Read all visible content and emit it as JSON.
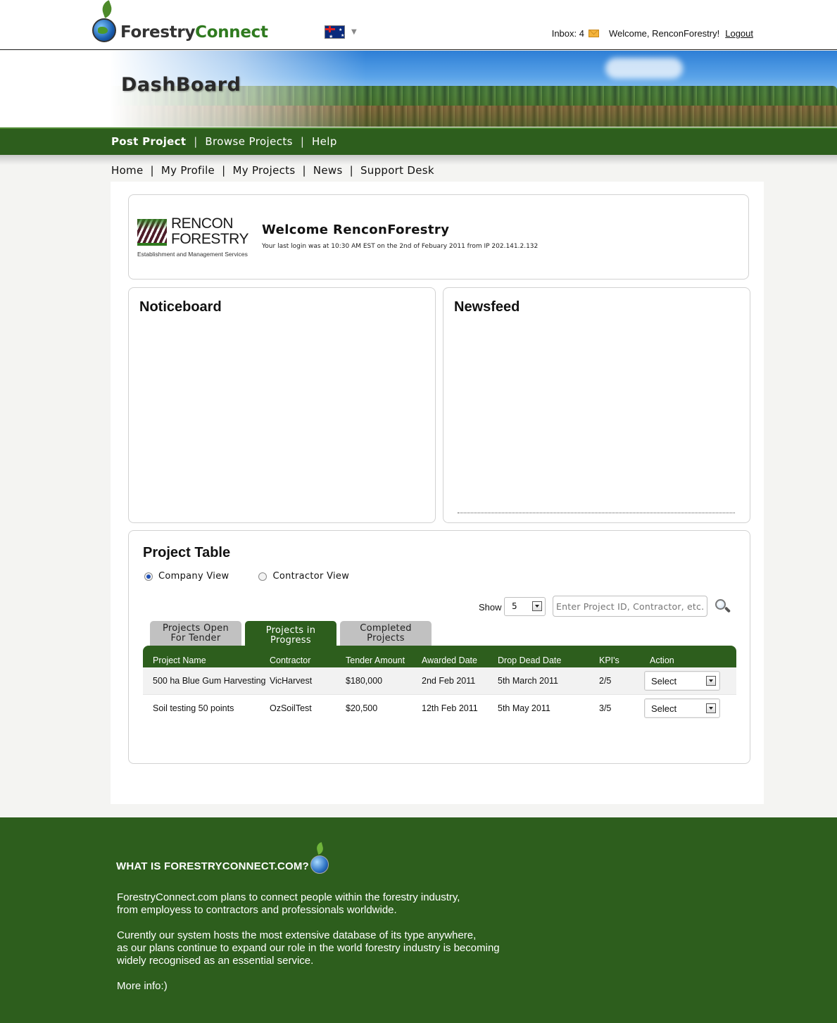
{
  "header": {
    "logo_part1": "Forestry",
    "logo_part2": "Connect",
    "inbox_label": "Inbox: 4",
    "welcome_text": "Welcome, RenconForestry!",
    "logout_label": "Logout"
  },
  "banner": {
    "title": "DashBoard"
  },
  "main_nav": {
    "items": [
      "Post Project",
      "Browse Projects",
      "Help"
    ]
  },
  "sub_nav": {
    "items": [
      "Home",
      "My Profile",
      "My Projects",
      "News",
      "Support Desk"
    ]
  },
  "welcome_card": {
    "company_name_line1": "RENCON",
    "company_name_line2": "FORESTRY",
    "company_tagline": "Establishment and Management Services",
    "title": "Welcome RenconForestry",
    "last_login": "Your last login was at 10:30 AM EST on the 2nd of Febuary 2011 from IP 202.141.2.132"
  },
  "noticeboard": {
    "title": "Noticeboard"
  },
  "newsfeed": {
    "title": "Newsfeed"
  },
  "project_table": {
    "title": "Project Table",
    "views": [
      {
        "label": "Company View",
        "selected": true
      },
      {
        "label": "Contractor View",
        "selected": false
      }
    ],
    "show_label": "Show",
    "show_value": "5",
    "search_placeholder": "Enter Project ID, Contractor, etc.",
    "tabs": [
      {
        "label_line1": "Projects Open",
        "label_line2": "For Tender",
        "active": false
      },
      {
        "label_line1": "Projects in",
        "label_line2": "Progress",
        "active": true
      },
      {
        "label_line1": "Completed",
        "label_line2": "Projects",
        "active": false
      }
    ],
    "columns": [
      "Project Name",
      "Contractor",
      "Tender Amount",
      "Awarded Date",
      "Drop Dead Date",
      "KPI's",
      "Action"
    ],
    "rows": [
      {
        "name": "500 ha Blue Gum Harvesting",
        "contractor": "VicHarvest",
        "amount": "$180,000",
        "awarded": "2nd Feb 2011",
        "drop_dead": "5th March 2011",
        "kpi": "2/5",
        "action": "Select"
      },
      {
        "name": "Soil testing 50 points",
        "contractor": "OzSoilTest",
        "amount": "$20,500",
        "awarded": "12th Feb 2011",
        "drop_dead": "5th May 2011",
        "kpi": "3/5",
        "action": "Select"
      }
    ]
  },
  "footer": {
    "title": "WHAT IS  FORESTRYCONNECT.COM?",
    "para1_line1": "ForestryConnect.com plans to connect people within the forestry industry,",
    "para1_line2": "from employess to contractors and professionals worldwide.",
    "para2_line1": "Curently our system hosts the most extensive database of its type anywhere,",
    "para2_line2": "as our plans continue to expand our role in the world forestry industry is becoming",
    "para2_line3": "widely recognised as an essential service.",
    "more_info": "More info:)"
  },
  "colors": {
    "brand_green": "#2d5e1d",
    "logo_green": "#2f7a1f",
    "footer_green": "#2d5e1d",
    "tab_grey": "#c1c1c1"
  }
}
